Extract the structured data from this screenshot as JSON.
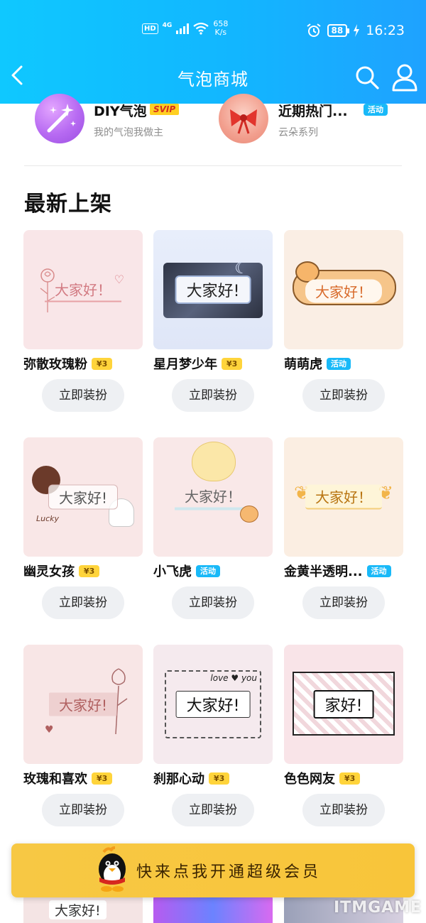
{
  "status_bar": {
    "hd": "HD",
    "network": "4G",
    "speed_value": "658",
    "speed_unit": "K/s",
    "battery": "88",
    "time": "16:23"
  },
  "header": {
    "title": "气泡商城",
    "back_icon": "chevron-left-icon",
    "search_icon": "search-icon",
    "user_icon": "user-icon",
    "color": "#12b6ff"
  },
  "featured": [
    {
      "title": "DIY气泡",
      "badge": "SVIP",
      "subtitle": "我的气泡我做主",
      "icon": "magic-wand-icon"
    },
    {
      "title": "近期热门...",
      "badge": "活动",
      "subtitle": "云朵系列",
      "icon": "bow-icon"
    }
  ],
  "section": {
    "title": "最新上架"
  },
  "items": [
    {
      "name": "弥散玫瑰粉",
      "badge": "¥3",
      "badge_type": "price",
      "preview_text": "大家好！",
      "action": "立即装扮",
      "bg": "#f9e6e8"
    },
    {
      "name": "星月梦少年",
      "badge": "¥3",
      "badge_type": "price",
      "preview_text": "大家好!",
      "action": "立即装扮",
      "bg": "#e5ecf8"
    },
    {
      "name": "萌萌虎",
      "badge": "活动",
      "badge_type": "activity",
      "preview_text": "大家好！",
      "action": "立即装扮",
      "bg": "#faeee4"
    },
    {
      "name": "幽灵女孩",
      "badge": "¥3",
      "badge_type": "price",
      "preview_text": "大家好!",
      "action": "立即装扮",
      "bg": "#f9e7e7"
    },
    {
      "name": "小飞虎",
      "badge": "活动",
      "badge_type": "activity",
      "preview_text": "大家好！",
      "action": "立即装扮",
      "bg": "#f9e8e8"
    },
    {
      "name": "金黄半透明...",
      "badge": "活动",
      "badge_type": "activity",
      "preview_text": "大家好！",
      "action": "立即装扮",
      "bg": "#fbeee2"
    },
    {
      "name": "玫瑰和喜欢",
      "badge": "¥3",
      "badge_type": "price",
      "preview_text": "大家好!",
      "action": "立即装扮",
      "bg": "#f8e6e6"
    },
    {
      "name": "刹那心动",
      "badge": "¥3",
      "badge_type": "price",
      "preview_text": "大家好!",
      "action": "立即装扮",
      "bg": "#f5eaee"
    },
    {
      "name": "色色网友",
      "badge": "¥3",
      "badge_type": "price",
      "preview_text": "家好!",
      "action": "立即装扮",
      "bg": "#f9e4e8"
    }
  ],
  "bottom_peek": {
    "preview_text": "大家好!"
  },
  "vip_banner": {
    "text": "快来点我开通超级会员",
    "icon": "penguin-icon"
  },
  "watermark": {
    "text": "ITMGAME"
  }
}
